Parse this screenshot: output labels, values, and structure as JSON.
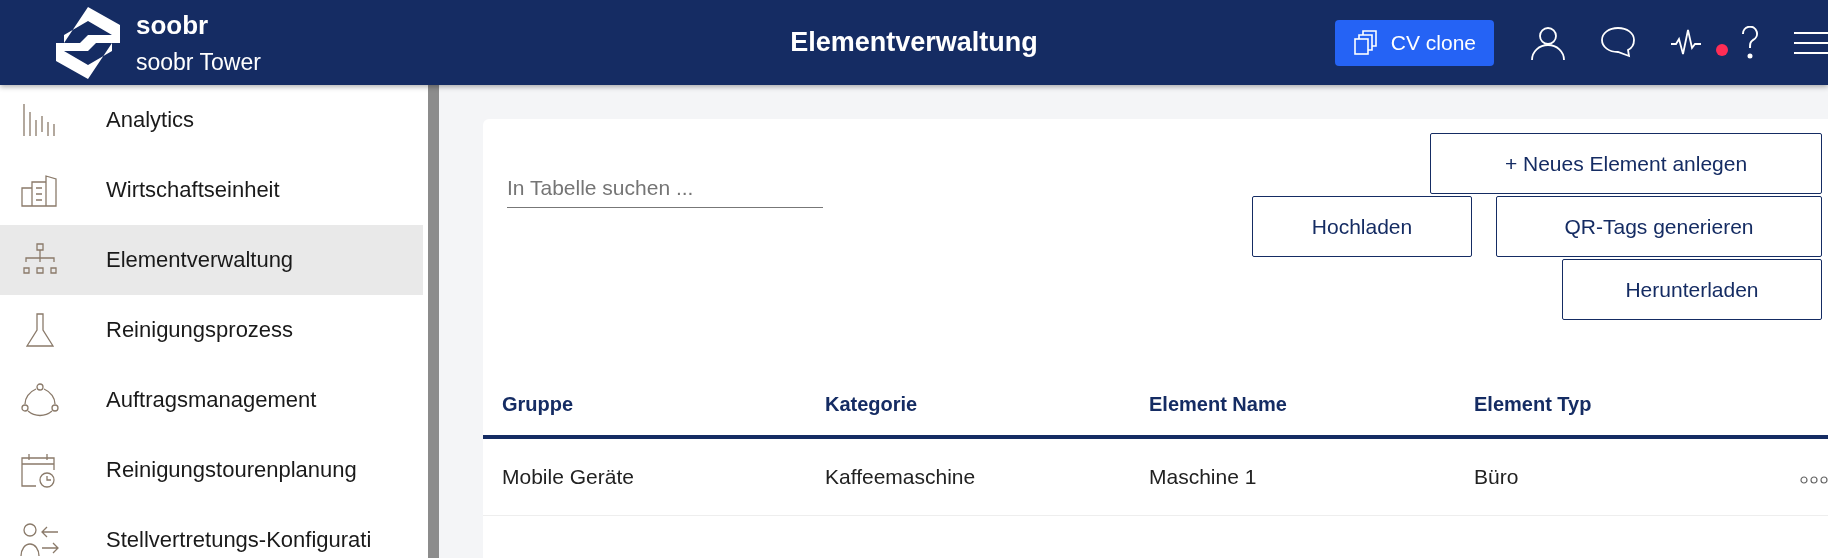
{
  "header": {
    "brand": "soobr",
    "subtitle": "soobr Tower",
    "title": "Elementverwaltung",
    "clone_button": "CV clone",
    "notification": true
  },
  "sidebar": {
    "items": [
      {
        "label": "Analytics",
        "selected": false
      },
      {
        "label": "Wirtschaftseinheit",
        "selected": false
      },
      {
        "label": "Elementverwaltung",
        "selected": true
      },
      {
        "label": "Reinigungsprozess",
        "selected": false
      },
      {
        "label": "Auftragsmanagement",
        "selected": false
      },
      {
        "label": "Reinigungstourenplanung",
        "selected": false
      },
      {
        "label": "Stellvertretungs-Konfigurati",
        "selected": false
      }
    ]
  },
  "search": {
    "placeholder": "In Tabelle suchen ..."
  },
  "actions": {
    "new_element": "+ Neues Element anlegen",
    "upload": "Hochladen",
    "qr_tags": "QR-Tags generieren",
    "download": "Herunterladen"
  },
  "table": {
    "columns": [
      "Gruppe",
      "Kategorie",
      "Element Name",
      "Element Typ"
    ],
    "rows": [
      {
        "cells": [
          "Mobile Geräte",
          "Kaffeemaschine",
          "Maschine 1",
          "Büro"
        ]
      }
    ]
  }
}
